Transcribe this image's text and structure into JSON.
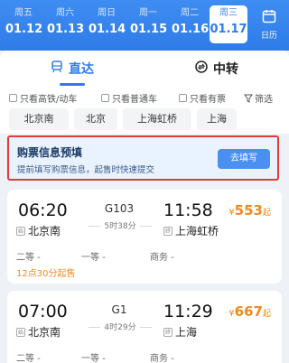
{
  "dates": [
    {
      "weekday": "周五",
      "date": "01.12"
    },
    {
      "weekday": "周六",
      "date": "01.13"
    },
    {
      "weekday": "周日",
      "date": "01.14"
    },
    {
      "weekday": "周一",
      "date": "01.15"
    },
    {
      "weekday": "周二",
      "date": "01.16"
    },
    {
      "weekday": "周三",
      "date": "01.17"
    }
  ],
  "calendar_label": "日历",
  "tabs": {
    "direct": "直达",
    "transfer": "中转"
  },
  "filters": {
    "high_speed": "只看高铁/动车",
    "normal": "只看普通车",
    "available": "只看有票",
    "filter_btn": "筛选"
  },
  "stations": [
    "北京南",
    "北京",
    "上海虹桥",
    "上海"
  ],
  "promo": {
    "title": "购票信息预填",
    "subtitle": "提前填写购票信息，起售时快速提交",
    "button": "去填写"
  },
  "trains": [
    {
      "depart_time": "06:20",
      "train_no": "G103",
      "duration": "5时38分",
      "arrive_time": "11:58",
      "from_station": "北京南",
      "to_station": "上海虹桥",
      "from_tag": "始",
      "to_tag": "终",
      "price_symbol": "¥",
      "price": "553",
      "price_suffix": "起",
      "seats": [
        "二等 -",
        "一等 -",
        "商务 -"
      ],
      "sale_time": "12点30分起售"
    },
    {
      "depart_time": "07:00",
      "train_no": "G1",
      "duration": "4时29分",
      "arrive_time": "11:29",
      "from_station": "北京南",
      "to_station": "上海",
      "from_tag": "始",
      "to_tag": "终",
      "price_symbol": "¥",
      "price": "667",
      "price_suffix": "起",
      "seats": [
        "二等 -",
        "一等 -",
        "商务 -"
      ]
    }
  ],
  "colors": {
    "primary": "#2f7be9",
    "price": "#f08a1e",
    "highlight_border": "#e23b3b"
  }
}
